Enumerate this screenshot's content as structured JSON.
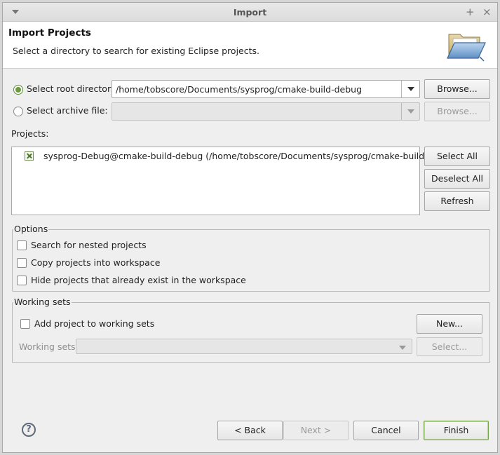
{
  "window": {
    "title": "Import",
    "maximize_glyph": "+",
    "close_glyph": "×"
  },
  "header": {
    "title": "Import Projects",
    "description": "Select a directory to search for existing Eclipse projects.",
    "icon": "folder-open-icon"
  },
  "source": {
    "root_label": "Select root directory:",
    "root_value": "/home/tobscore/Documents/sysprog/cmake-build-debug",
    "root_browse": "Browse...",
    "archive_label": "Select archive file:",
    "archive_value": "",
    "archive_browse": "Browse..."
  },
  "projects": {
    "label": "Projects:",
    "items": [
      {
        "name": "sysprog-Debug@cmake-build-debug (/home/tobscore/Documents/sysprog/cmake-build-debug)",
        "checked": true
      }
    ],
    "select_all": "Select All",
    "deselect_all": "Deselect All",
    "refresh": "Refresh"
  },
  "options": {
    "title": "Options",
    "items": [
      {
        "label": "Search for nested projects",
        "checked": false
      },
      {
        "label": "Copy projects into workspace",
        "checked": false
      },
      {
        "label": "Hide projects that already exist in the workspace",
        "checked": false
      }
    ]
  },
  "working_sets": {
    "title": "Working sets",
    "add_label": "Add project to working sets",
    "new_button": "New...",
    "sets_label": "Working sets:",
    "sets_value": "",
    "select_button": "Select..."
  },
  "footer": {
    "help": "?",
    "back": "< Back",
    "next": "Next >",
    "cancel": "Cancel",
    "finish": "Finish"
  },
  "colors": {
    "accent_green": "#6b9a3f",
    "window_bg": "#efefef"
  }
}
